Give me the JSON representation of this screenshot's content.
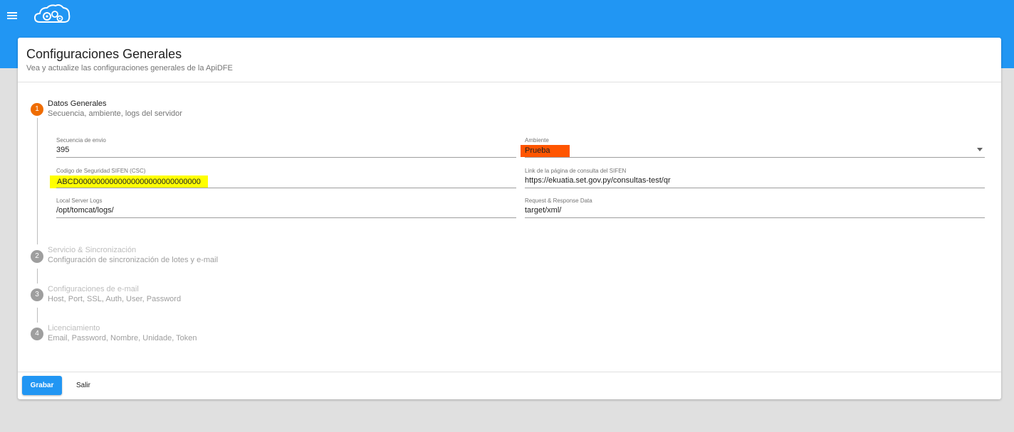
{
  "header": {
    "menu_icon": "menu-icon",
    "logo_icon": "cloud-gears-logo",
    "accent": "#2196f3"
  },
  "page": {
    "title": "Configuraciones Generales",
    "subtitle": "Vea y actualize las configuraciones generales de la ApiDFE"
  },
  "steps": [
    {
      "number": "1",
      "title": "Datos Generales",
      "subtitle": "Secuencia, ambiente, logs del servidor",
      "active": true
    },
    {
      "number": "2",
      "title": "Servicio & Sincronización",
      "subtitle": "Configuración de sincronización de lotes y e-mail",
      "active": false
    },
    {
      "number": "3",
      "title": "Configuraciones de e-mail",
      "subtitle": "Host, Port, SSL, Auth, User, Password",
      "active": false
    },
    {
      "number": "4",
      "title": "Licenciamiento",
      "subtitle": "Email, Password, Nombre, Unidade, Token",
      "active": false
    }
  ],
  "form": {
    "secuencia": {
      "label": "Secuencia de envio",
      "value": "395"
    },
    "ambiente": {
      "label": "Ambiente",
      "value": "Prueba"
    },
    "csc": {
      "label": "Codigo de Seguridad SIFEN (CSC)",
      "value": "ABCD0000000000000000000000000000"
    },
    "link": {
      "label": "Link de la página de consulta del SIFEN",
      "value": "https://ekuatia.set.gov.py/consultas-test/qr"
    },
    "logs": {
      "label": "Local Server Logs",
      "value": "/opt/tomcat/logs/"
    },
    "request": {
      "label": "Request & Response Data",
      "value": "target/xml/"
    }
  },
  "actions": {
    "grabar": "Grabar",
    "salir": "Salir"
  },
  "colors": {
    "active_step": "#ef6c00",
    "inactive_step": "#9e9e9e",
    "highlight_yellow": "#ffff00",
    "highlight_orange": "#ff5500"
  }
}
